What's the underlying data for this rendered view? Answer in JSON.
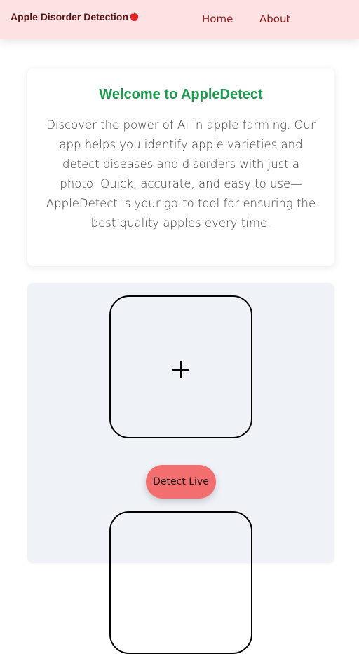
{
  "navbar": {
    "brand": "Apple Disorder Detection",
    "brand_icon": "red-apple-icon",
    "links": [
      {
        "label": "Home"
      },
      {
        "label": "About"
      }
    ],
    "background_color": "#fde2e4"
  },
  "welcome": {
    "title": "Welcome to AppleDetect",
    "description": "Discover the power of AI in apple farming. Our app helps you identify apple varieties and detect diseases and disorders with just a photo. Quick, accurate, and easy to use—AppleDetect is your go-to tool for ensuring the best quality apples every time.",
    "title_color": "#1e9a4e"
  },
  "upload": {
    "upload_icon": "plus-icon",
    "detect_button_label": "Detect Live",
    "button_color": "#f36f6f",
    "section_background": "#eff2f7"
  }
}
